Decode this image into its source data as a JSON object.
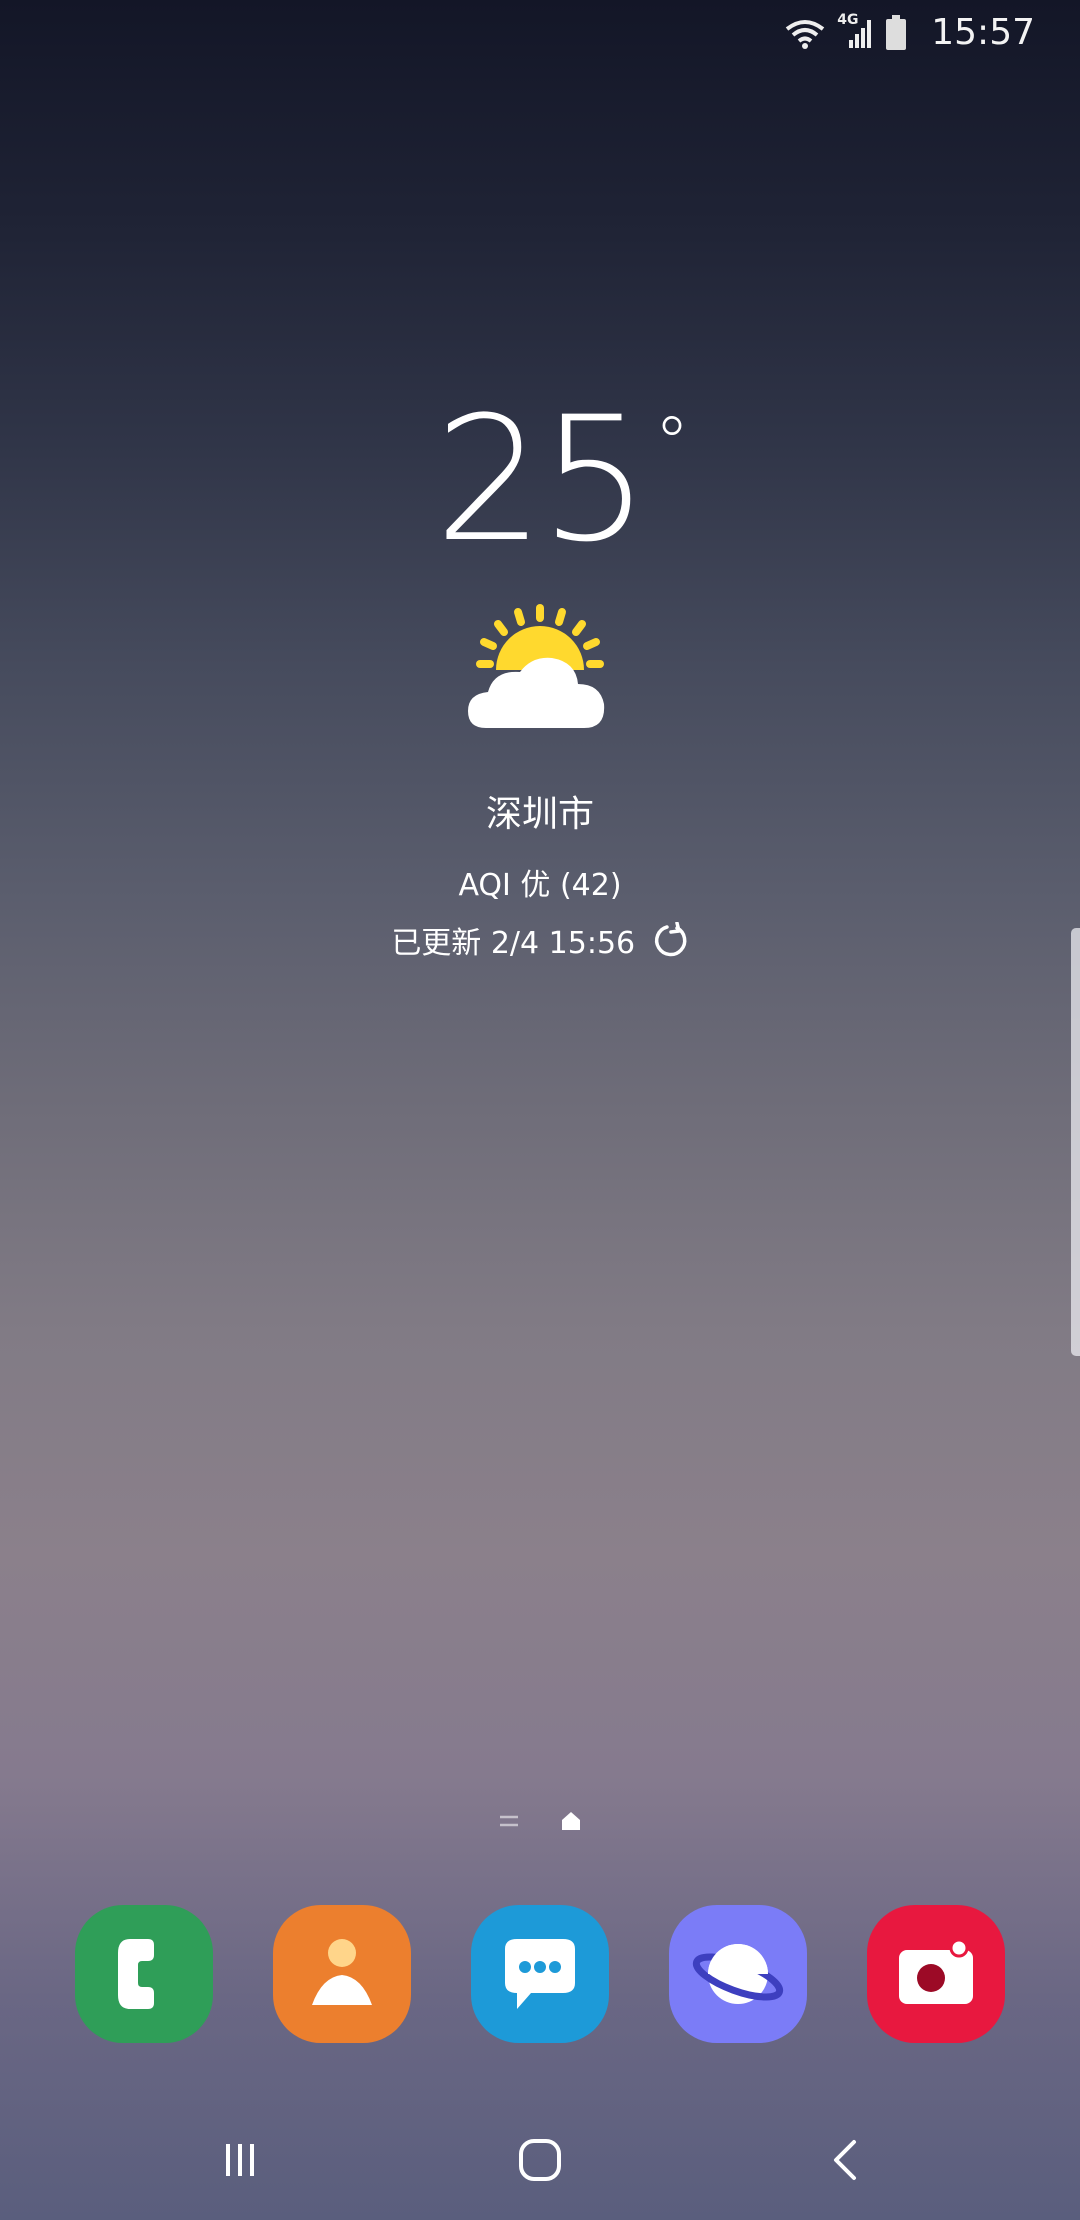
{
  "status_bar": {
    "time": "15:57",
    "network": "4G",
    "icons": [
      "wifi-icon",
      "cellular-signal-icon",
      "battery-icon"
    ]
  },
  "weather": {
    "temperature": "25",
    "degree": "°",
    "condition_icon": "partly-sunny-icon",
    "city": "深圳市",
    "aqi": "AQI 优 (42)",
    "updated": "已更新 2/4 15:56"
  },
  "dock": {
    "apps": [
      {
        "name": "Phone",
        "icon": "phone-icon",
        "color": "#2f9e58"
      },
      {
        "name": "Contacts",
        "icon": "contacts-icon",
        "color": "#ec7f2e"
      },
      {
        "name": "Messages",
        "icon": "messages-icon",
        "color": "#1d9ad8"
      },
      {
        "name": "Internet",
        "icon": "internet-icon",
        "color": "#7b7cf7"
      },
      {
        "name": "Camera",
        "icon": "camera-icon",
        "color": "#e8183f"
      }
    ]
  },
  "nav_bar": {
    "buttons": [
      "recents-icon",
      "home-icon",
      "back-icon"
    ]
  }
}
